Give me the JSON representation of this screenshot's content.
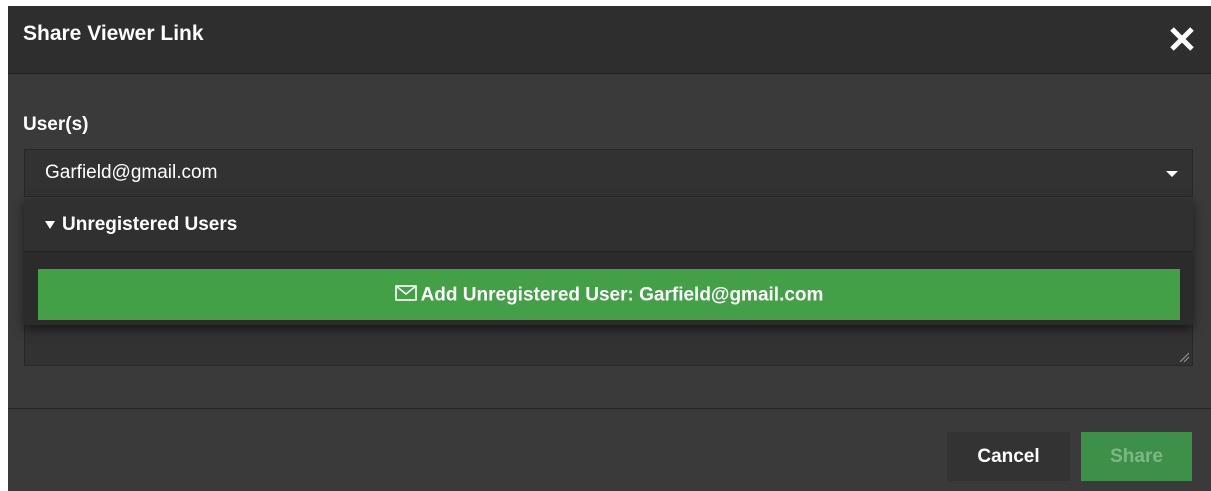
{
  "dialog": {
    "title": "Share Viewer Link",
    "close_icon": "close-icon"
  },
  "form": {
    "users_label": "User(s)",
    "users_select": {
      "value": "Garfield@gmail.com",
      "caret_icon": "caret-down-icon"
    }
  },
  "dropdown": {
    "group_label": "Unregistered Users",
    "group_icon": "triangle-down-icon",
    "option": {
      "icon": "mail-icon",
      "label": "Add Unregistered User: Garfield@gmail.com"
    }
  },
  "footer": {
    "cancel_label": "Cancel",
    "share_label": "Share"
  },
  "colors": {
    "dialog_bg": "#3a3a3a",
    "header_bg": "#2e2e2e",
    "accent_green": "#43a047",
    "share_disabled_text": "#7cb884"
  }
}
